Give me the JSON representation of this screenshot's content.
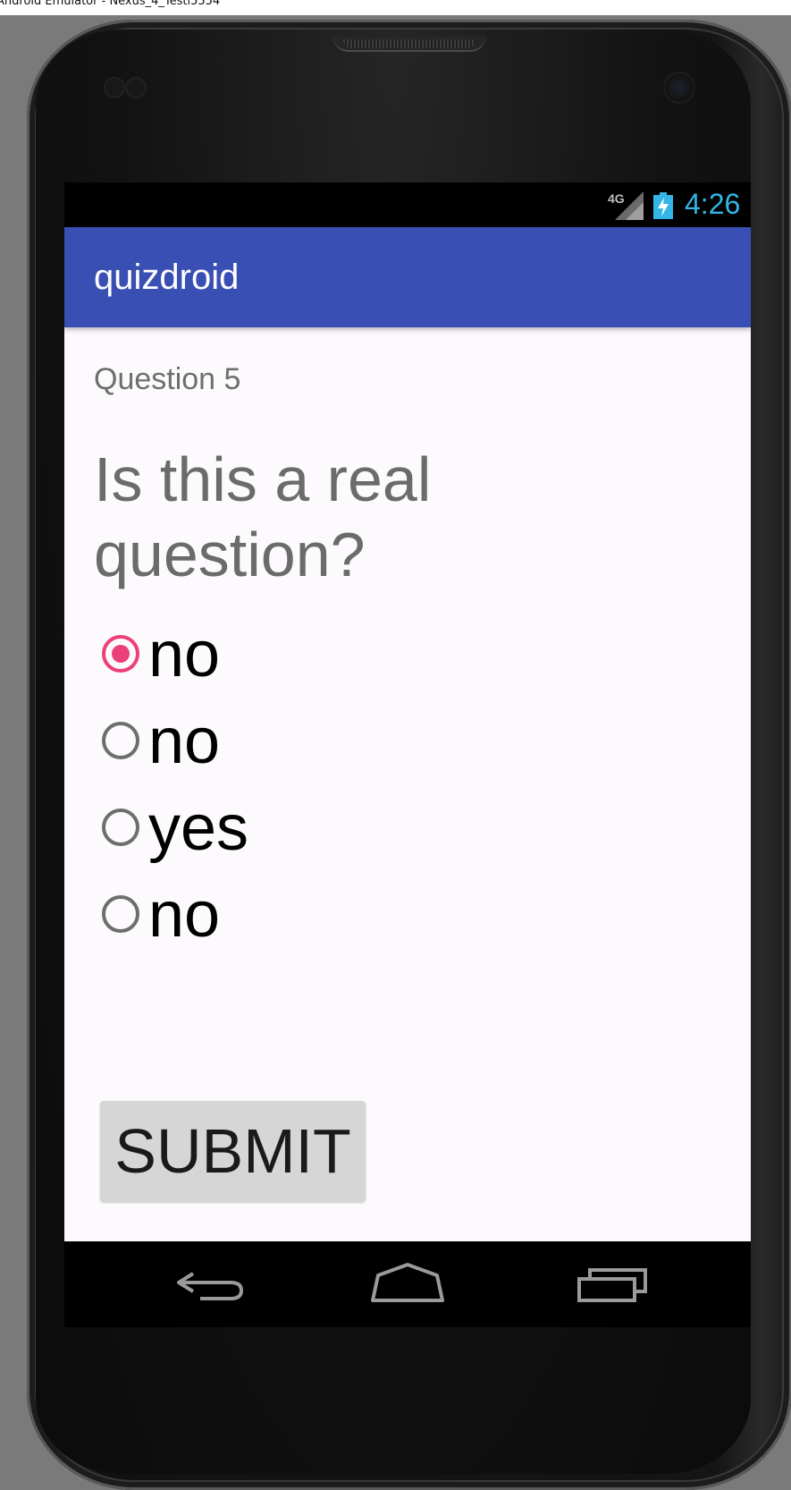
{
  "window": {
    "title": "Android Emulator - Nexus_4_Testi5554"
  },
  "status_bar": {
    "network_label": "4G",
    "time": "4:26",
    "icons": [
      "signal-icon",
      "battery-charging-icon"
    ],
    "time_color": "#33b5e5"
  },
  "app_bar": {
    "title": "quizdroid",
    "color": "#3a4fb4"
  },
  "main": {
    "question_number": "Question 5",
    "question_text": "Is this a real question?",
    "options": [
      {
        "label": "no",
        "selected": true
      },
      {
        "label": "no",
        "selected": false
      },
      {
        "label": "yes",
        "selected": false
      },
      {
        "label": "no",
        "selected": false
      }
    ],
    "accent_color": "#ec407a",
    "submit_label": "SUBMIT"
  },
  "nav_bar": {
    "icons": [
      "back-icon",
      "home-icon",
      "recent-apps-icon"
    ]
  }
}
